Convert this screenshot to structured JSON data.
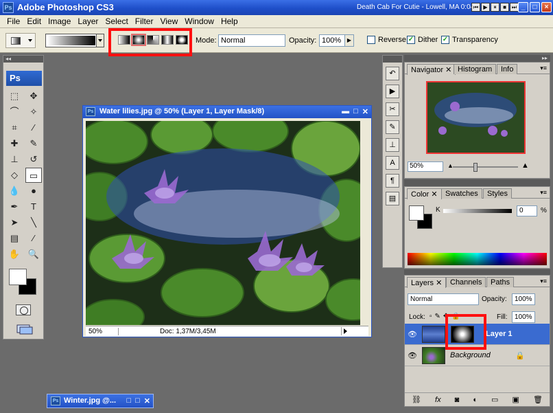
{
  "app": {
    "title": "Adobe Photoshop CS3",
    "now_playing": "Death Cab For Cutie - Lowell, MA  0:04"
  },
  "menu": [
    "File",
    "Edit",
    "Image",
    "Layer",
    "Select",
    "Filter",
    "View",
    "Window",
    "Help"
  ],
  "options": {
    "mode_label": "Mode:",
    "mode_value": "Normal",
    "opacity_label": "Opacity:",
    "opacity_value": "100%",
    "reverse_label": "Reverse",
    "dither_label": "Dither",
    "transparency_label": "Transparency",
    "reverse_checked": false,
    "dither_checked": true,
    "transparency_checked": true
  },
  "toolbox": {
    "logo": "Ps"
  },
  "document": {
    "title": "Water lilies.jpg @ 50% (Layer 1, Layer Mask/8)",
    "zoom": "50%",
    "doc_info": "Doc: 1,37M/3,45M"
  },
  "minimized": {
    "title": "Winter.jpg @..."
  },
  "navigator": {
    "tabs": [
      "Navigator",
      "Histogram",
      "Info"
    ],
    "zoom": "50%"
  },
  "color_panel": {
    "tabs": [
      "Color",
      "Swatches",
      "Styles"
    ],
    "channel_label": "K",
    "value": "0",
    "unit": "%"
  },
  "layers_panel": {
    "tabs": [
      "Layers",
      "Channels",
      "Paths"
    ],
    "blend_mode": "Normal",
    "opacity_label": "Opacity:",
    "opacity_value": "100%",
    "lock_label": "Lock:",
    "fill_label": "Fill:",
    "fill_value": "100%",
    "layers": [
      {
        "name": "Layer 1",
        "selected": true
      },
      {
        "name": "Background",
        "selected": false
      }
    ]
  },
  "colors": {
    "accent": "#2352c6",
    "highlight": "#ff1010",
    "selection": "#3a6bd0"
  }
}
